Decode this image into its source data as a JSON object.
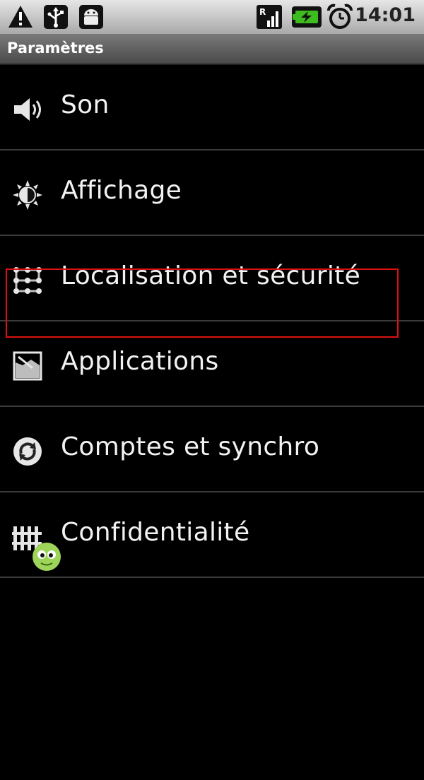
{
  "status_bar": {
    "time": "14:01",
    "left_icons": [
      "warning-icon",
      "usb-icon",
      "android-icon"
    ],
    "right_icons": [
      "signal-icon",
      "battery-charging-icon",
      "alarm-clock-icon"
    ]
  },
  "title": "Paramètres",
  "settings_list": [
    {
      "label": "Son",
      "icon": "speaker-icon"
    },
    {
      "label": "Affichage",
      "icon": "brightness-icon"
    },
    {
      "label": "Localisation et sécurité",
      "icon": "pattern-lock-icon",
      "highlighted": true
    },
    {
      "label": "Applications",
      "icon": "applications-icon"
    },
    {
      "label": "Comptes et synchro",
      "icon": "sync-icon"
    },
    {
      "label": "Confidentialité",
      "icon": "privacy-icon"
    }
  ],
  "colors": {
    "highlight_border": "#dd1111",
    "background": "#000000",
    "divider": "#3b3b3b"
  }
}
